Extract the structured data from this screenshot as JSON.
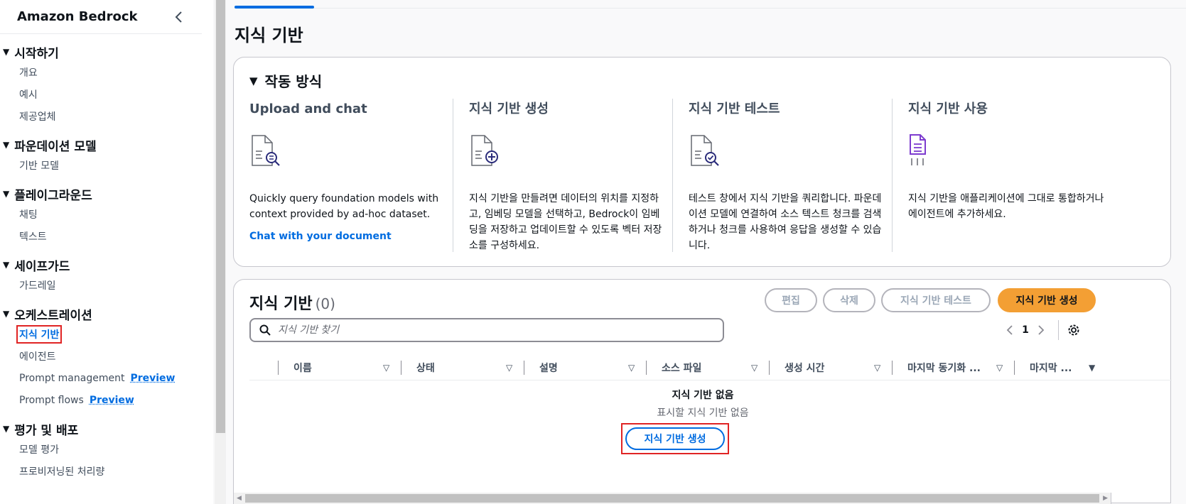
{
  "sidebar": {
    "title": "Amazon Bedrock",
    "sections": [
      {
        "title": "시작하기",
        "items": [
          {
            "label": "개요"
          },
          {
            "label": "예시"
          },
          {
            "label": "제공업체"
          }
        ]
      },
      {
        "title": "파운데이션 모델",
        "items": [
          {
            "label": "기반 모델"
          }
        ]
      },
      {
        "title": "플레이그라운드",
        "items": [
          {
            "label": "채팅"
          },
          {
            "label": "텍스트"
          }
        ]
      },
      {
        "title": "세이프가드",
        "items": [
          {
            "label": "가드레일"
          }
        ]
      },
      {
        "title": "오케스트레이션",
        "items": [
          {
            "label": "지식 기반"
          },
          {
            "label": "에이전트"
          },
          {
            "label": "Prompt management",
            "badge": "Preview"
          },
          {
            "label": "Prompt flows",
            "badge": "Preview"
          }
        ]
      },
      {
        "title": "평가 및 배포",
        "items": [
          {
            "label": "모델 평가"
          },
          {
            "label": "프로비저닝된 처리량"
          }
        ]
      }
    ]
  },
  "page": {
    "title": "지식 기반"
  },
  "how_it_works": {
    "title": "작동 방식",
    "columns": [
      {
        "heading": "Upload and chat",
        "icon": "document-search-icon",
        "text": "Quickly query foundation models with context provided by ad-hoc dataset.",
        "link": "Chat with your document"
      },
      {
        "heading": "지식 기반 생성",
        "icon": "document-add-icon",
        "text": "지식 기반을 만들려면 데이터의 위치를 지정하고, 임베딩 모델을 선택하고, Bedrock이 임베딩을 저장하고 업데이트할 수 있도록 벡터 저장소를 구성하세요."
      },
      {
        "heading": "지식 기반 테스트",
        "icon": "document-check-icon",
        "text": "테스트 창에서 지식 기반을 쿼리합니다. 파운데이션 모델에 연결하여 소스 텍스트 청크를 검색하거나 청크를 사용하여 응답을 생성할 수 있습니다."
      },
      {
        "heading": "지식 기반 사용",
        "icon": "document-integrate-icon",
        "text": "지식 기반을 애플리케이션에 그대로 통합하거나 에이전트에 추가하세요."
      }
    ]
  },
  "kb_table": {
    "title": "지식 기반",
    "count": "(0)",
    "buttons": {
      "edit": "편집",
      "delete": "삭제",
      "test": "지식 기반 테스트",
      "create": "지식 기반 생성"
    },
    "search_placeholder": "지식 기반 찾기",
    "pager": {
      "page": "1"
    },
    "columns": [
      "이름",
      "상태",
      "설명",
      "소스 파일",
      "생성 시간",
      "마지막 동기화 ...",
      "마지막 ..."
    ],
    "empty": {
      "title": "지식 기반 없음",
      "subtitle": "표시할 지식 기반 없음",
      "button": "지식 기반 생성"
    }
  },
  "colors": {
    "accent": "#006ce0",
    "primary_button": "#f39f34",
    "highlight": "#e02424",
    "icon_purple": "#7d3ccf"
  }
}
